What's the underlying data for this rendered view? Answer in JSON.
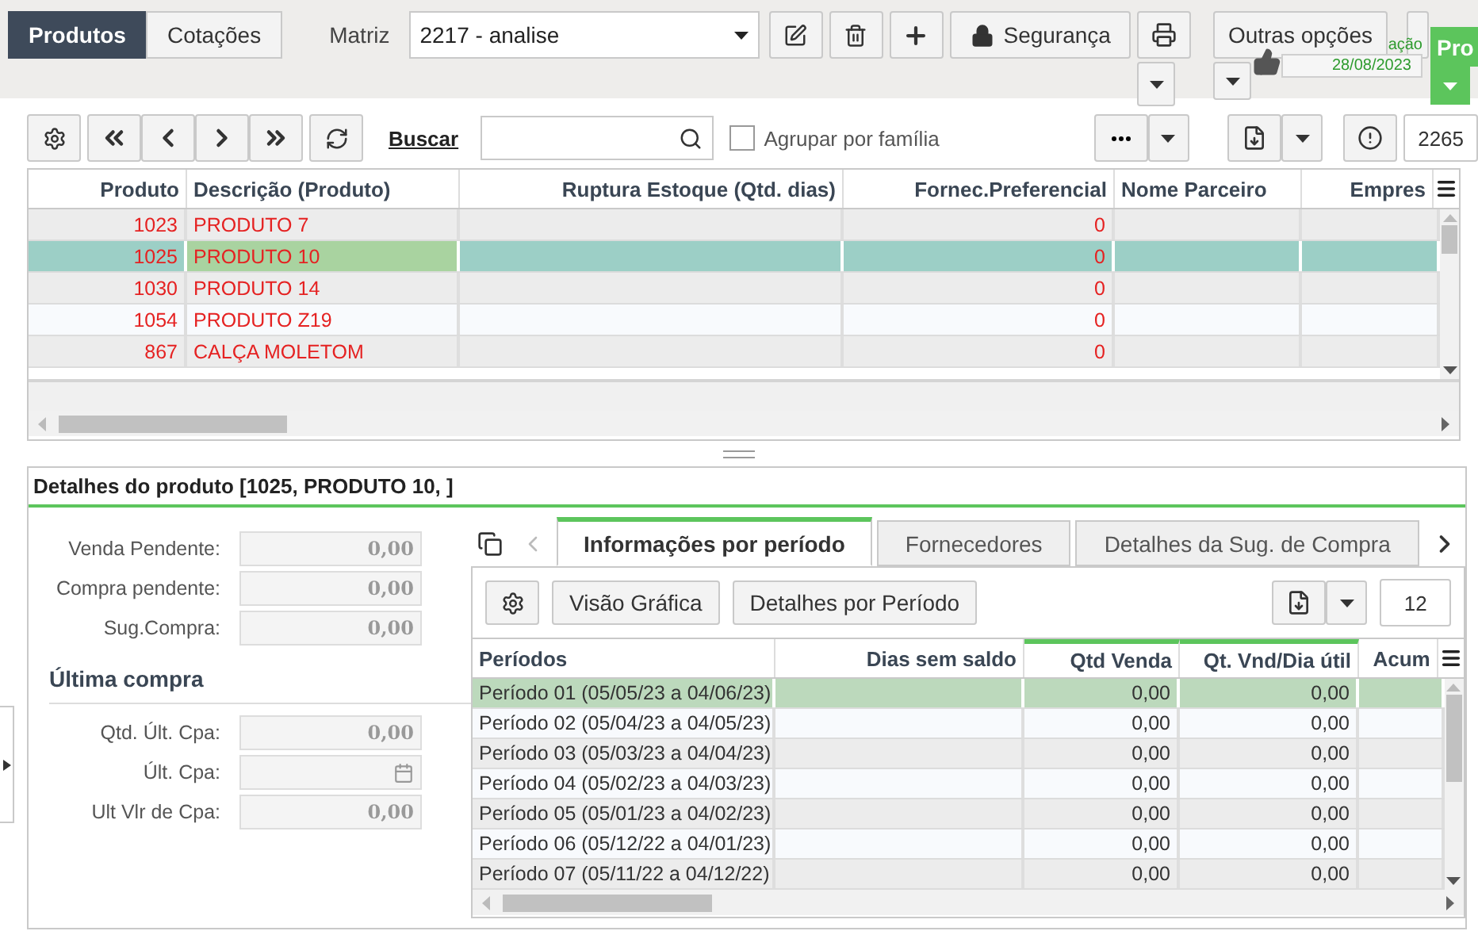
{
  "top_tabs": [
    {
      "label": "Produtos",
      "selected": true
    },
    {
      "label": "Cotações",
      "selected": false
    }
  ],
  "matriz": {
    "label": "Matriz",
    "value": "2217 - analise"
  },
  "security_button": "Segurança",
  "other_options_button": "Outras opções",
  "notice": {
    "partial_text": "ação",
    "date": "28/08/2023"
  },
  "green_button": "Pro",
  "search": {
    "link": "Buscar"
  },
  "group_checkbox": {
    "label": "Agrupar por família",
    "checked": false
  },
  "record_count": "2265",
  "products_table": {
    "columns": [
      "Produto",
      "Descrição (Produto)",
      "Ruptura Estoque (Qtd. dias)",
      "Fornec.Preferencial",
      "Nome Parceiro",
      "Empres"
    ],
    "rows": [
      {
        "produto": "1023",
        "descricao": "PRODUTO 7",
        "fornec": "0",
        "selected": false
      },
      {
        "produto": "1025",
        "descricao": "PRODUTO 10",
        "fornec": "0",
        "selected": true
      },
      {
        "produto": "1030",
        "descricao": "PRODUTO 14",
        "fornec": "0",
        "selected": false
      },
      {
        "produto": "1054",
        "descricao": "PRODUTO Z19",
        "fornec": "0",
        "selected": false
      },
      {
        "produto": "867",
        "descricao": "CALÇA MOLETOM",
        "fornec": "0",
        "selected": false
      }
    ]
  },
  "details": {
    "title": "Detalhes do produto [1025, PRODUTO 10, ]",
    "fields": [
      {
        "label": "Venda Pendente:",
        "value": "0,00",
        "kind": "number"
      },
      {
        "label": "Compra pendente:",
        "value": "0,00",
        "kind": "number"
      },
      {
        "label": "Sug.Compra:",
        "value": "0,00",
        "kind": "number"
      }
    ],
    "section_title": "Última compra",
    "last_purchase_fields": [
      {
        "label": "Qtd. Últ. Cpa:",
        "value": "0,00",
        "kind": "number"
      },
      {
        "label": "Últ. Cpa:",
        "kind": "date"
      },
      {
        "label": "Ult Vlr de Cpa:",
        "value": "0,00",
        "kind": "number"
      }
    ]
  },
  "detail_tabs": [
    {
      "label": "Informações por período",
      "selected": true
    },
    {
      "label": "Fornecedores",
      "selected": false
    },
    {
      "label": "Detalhes da Sug. de Compra",
      "selected": false
    }
  ],
  "period_buttons": [
    "Visão Gráfica",
    "Detalhes por Período"
  ],
  "period_count": "12",
  "periods_table": {
    "columns": [
      {
        "label": "Períodos",
        "highlighted": false
      },
      {
        "label": "Dias sem saldo",
        "highlighted": false
      },
      {
        "label": "Qtd Venda",
        "highlighted": true
      },
      {
        "label": "Qt. Vnd/Dia útil",
        "highlighted": true
      },
      {
        "label": "Acum",
        "highlighted": false
      }
    ],
    "rows": [
      {
        "periodo": "Período 01 (05/05/23 a 04/06/23)",
        "qtd_venda": "0,00",
        "qt_vnd_dia": "0,00",
        "selected": true
      },
      {
        "periodo": "Período 02 (05/04/23 a 04/05/23)",
        "qtd_venda": "0,00",
        "qt_vnd_dia": "0,00",
        "selected": false
      },
      {
        "periodo": "Período 03 (05/03/23 a 04/04/23)",
        "qtd_venda": "0,00",
        "qt_vnd_dia": "0,00",
        "selected": false
      },
      {
        "periodo": "Período 04 (05/02/23 a 04/03/23)",
        "qtd_venda": "0,00",
        "qt_vnd_dia": "0,00",
        "selected": false
      },
      {
        "periodo": "Período 05 (05/01/23 a 04/02/23)",
        "qtd_venda": "0,00",
        "qt_vnd_dia": "0,00",
        "selected": false
      },
      {
        "periodo": "Período 06 (05/12/22 a 04/01/23)",
        "qtd_venda": "0,00",
        "qt_vnd_dia": "0,00",
        "selected": false
      },
      {
        "periodo": "Período 07 (05/11/22 a 04/12/22)",
        "qtd_venda": "0,00",
        "qt_vnd_dia": "0,00",
        "selected": false
      }
    ]
  }
}
